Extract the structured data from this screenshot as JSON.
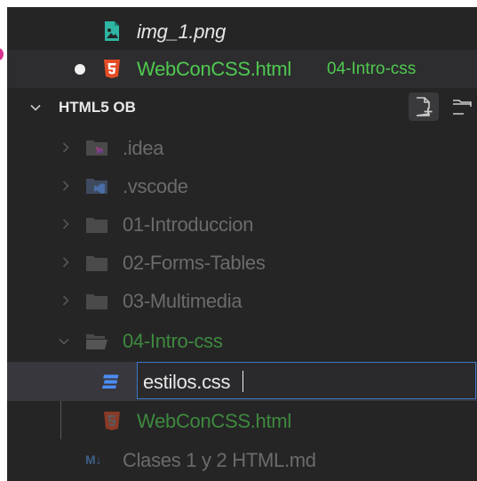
{
  "open_editors": [
    {
      "name": "img_1.png",
      "italic": true
    },
    {
      "name": "WebConCSS.html",
      "path": "04-Intro-css",
      "modified": true
    }
  ],
  "explorer": {
    "section_title": "HTML5 OB",
    "actions": [
      {
        "icon": "new-file-icon"
      },
      {
        "icon": "new-folder-icon"
      }
    ],
    "items": [
      {
        "name": ".idea",
        "kind": "folder",
        "icon": "idea-folder-icon"
      },
      {
        "name": ".vscode",
        "kind": "folder",
        "icon": "vscode-folder-icon"
      },
      {
        "name": "01-Introduccion",
        "kind": "folder"
      },
      {
        "name": "02-Forms-Tables",
        "kind": "folder"
      },
      {
        "name": "03-Multimedia",
        "kind": "folder"
      },
      {
        "name": "04-Intro-css",
        "kind": "folder",
        "expanded": true
      },
      {
        "name": "estilos.css",
        "kind": "new-file-input",
        "icon": "css-icon"
      },
      {
        "name": "WebConCSS.html",
        "kind": "file",
        "icon": "html-icon"
      },
      {
        "name": "Clases 1 y 2 HTML.md",
        "kind": "file",
        "icon": "markdown-icon",
        "icon_text": "M↓"
      }
    ]
  },
  "colors": {
    "sidebar_bg": "#252526",
    "selected_bg": "#37373d",
    "input_border": "#3c78c4",
    "git_green": "#4fc94f",
    "html_orange": "#e44d26",
    "css_blue": "#4c8cf5",
    "image_teal": "#2fb5a3"
  }
}
